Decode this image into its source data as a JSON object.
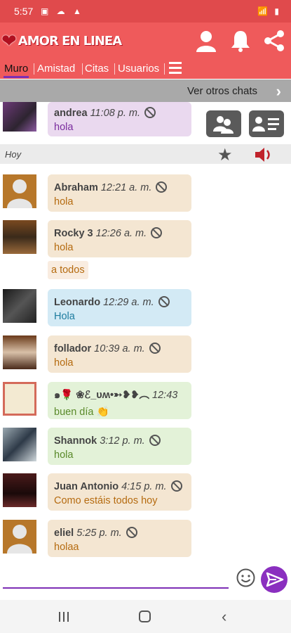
{
  "status_bar": {
    "time": "5:57"
  },
  "app": {
    "title": "AMOR EN LINEA"
  },
  "tabs": [
    {
      "label": "Muro",
      "active": true
    },
    {
      "label": "Amistad"
    },
    {
      "label": "Citas"
    },
    {
      "label": "Usuarios"
    }
  ],
  "other_chats_label": "Ver otros chats",
  "day_label": "Hoy",
  "messages": [
    {
      "name": "andrea",
      "time": "11:08 p. m.",
      "text": "hola",
      "color": "#ead9ef"
    },
    {
      "name": "Abraham",
      "time": "12:21 a. m.",
      "text": "hola",
      "color": "#f4e6d2"
    },
    {
      "name": "Rocky 3",
      "time": "12:26 a. m.",
      "text": "hola",
      "color": "#f4e6d2"
    },
    {
      "name": "Leonardo",
      "time": "12:29 a. m.",
      "text": "Hola",
      "color": "#d3eaf5"
    },
    {
      "name": "follador",
      "time": "10:39 a. m.",
      "text": "hola",
      "color": "#f4e6d2"
    },
    {
      "name": "๑🌹 ❀ℰ_ᴜʍ•➳❥❥︵",
      "time": "12:43",
      "text": "buen día 👏",
      "color": "#e3f2d8"
    },
    {
      "name": "Shannok",
      "time": "3:12 p. m.",
      "text": "hola",
      "color": "#e3f2d8"
    },
    {
      "name": "Juan Antonio",
      "time": "4:15 p. m.",
      "text": "Como estáis todos hoy",
      "color": "#f4e6d2"
    },
    {
      "name": "eliel",
      "time": "5:25 p. m.",
      "text": "holaa",
      "color": "#f4e6d2"
    }
  ],
  "standalone_message": "a todos",
  "icons": {
    "heart": "heart-logo-icon",
    "profile": "profile-icon",
    "bell": "bell-icon",
    "share": "share-icon",
    "menu": "menu-icon",
    "chevron": "chevron-right-icon",
    "group": "group-icon",
    "contact_card": "contact-card-icon",
    "star": "star-icon",
    "speaker": "speaker-icon",
    "ban": "ban-icon",
    "emoji": "emoji-icon",
    "send": "send-icon"
  }
}
